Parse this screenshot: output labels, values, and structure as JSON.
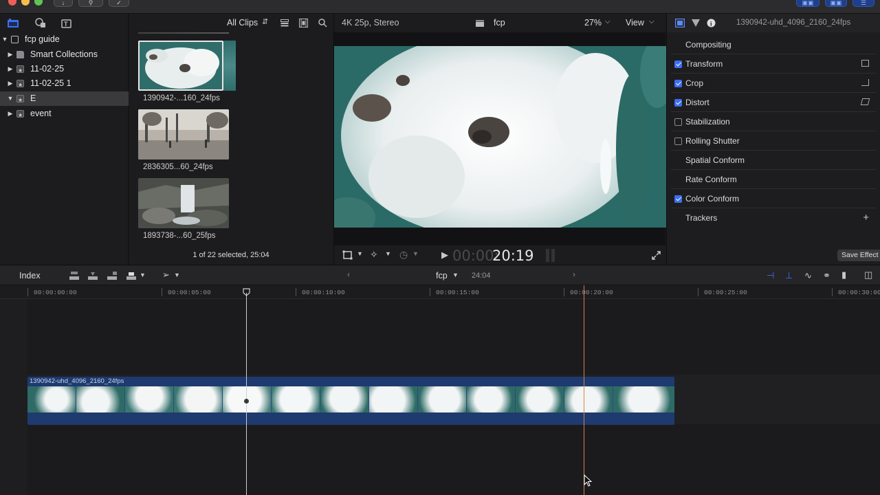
{
  "browser": {
    "filter_label": "All Clips",
    "clips": [
      {
        "label": "1390942-...160_24fps"
      },
      {
        "label": "2836305...60_24fps"
      },
      {
        "label": "1893738-...60_25fps"
      }
    ],
    "selection_status": "1 of 22 selected, 25:04"
  },
  "library": {
    "name": "fcp guide",
    "items": [
      {
        "label": "Smart Collections"
      },
      {
        "label": "11-02-25"
      },
      {
        "label": "11-02-25 1"
      },
      {
        "label": "E"
      },
      {
        "label": "event"
      }
    ]
  },
  "viewer": {
    "format": "4K 25p, Stereo",
    "project_name": "fcp",
    "zoom": "27%",
    "view_label": "View",
    "timecode_dim": "00:00:",
    "timecode_bright": "20:19"
  },
  "inspector": {
    "clip_name": "1390942-uhd_4096_2160_24fps",
    "rows": [
      {
        "label": "Compositing",
        "checked": null
      },
      {
        "label": "Transform",
        "checked": true
      },
      {
        "label": "Crop",
        "checked": true
      },
      {
        "label": "Distort",
        "checked": true
      },
      {
        "label": "Stabilization",
        "checked": false
      },
      {
        "label": "Rolling Shutter",
        "checked": false
      },
      {
        "label": "Spatial Conform",
        "checked": null
      },
      {
        "label": "Rate Conform",
        "checked": null
      },
      {
        "label": "Color Conform",
        "checked": true
      },
      {
        "label": "Trackers",
        "checked": null
      }
    ],
    "trackers_add": "+",
    "save_effects": "Save Effect"
  },
  "timeline": {
    "index_label": "Index",
    "project_name": "fcp",
    "duration": "24:04",
    "ruler_labels": [
      "00:00:00:00",
      "00:00:05:00",
      "00:00:10:00",
      "00:00:15:00",
      "00:00:20:00",
      "00:00:25:00",
      "00:00:30:00"
    ],
    "clip_name": "1390942-uhd_4096_2160_24fps"
  },
  "colors": {
    "accent_blue": "#3d6ff0",
    "clip_blue": "#1e3a6e",
    "playhead_orange": "#d9824a",
    "skimmer_white": "#d0d0d0"
  }
}
